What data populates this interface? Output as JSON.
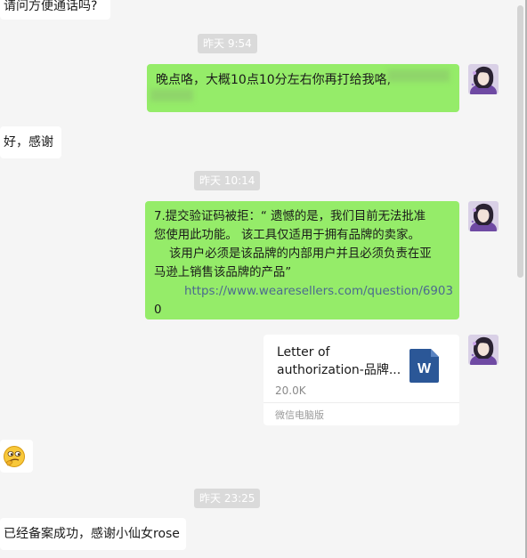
{
  "messages": {
    "m0": "请问方便通话吗?",
    "m1": "晚点咯，大概10点10分左右你再打给我咯,",
    "m2": "好，感谢",
    "m3_line1": "7.提交验证码被拒：“ 遗憾的是，我们目前无法批准",
    "m3_line2": "您使用此功能。 该工具仅适用于拥有品牌的卖家。",
    "m3_line3": "    该用户必须是该品牌的内部用户并且必须负责在亚",
    "m3_line4": "马逊上销售该品牌的产品”",
    "m3_link1": "        https://www.wearesellers.com/question/6903",
    "m3_link2": "0",
    "m5": "已经备案成功，感谢小仙女rose"
  },
  "timestamps": {
    "t1": "昨天 9:54",
    "t2": "昨天 10:14",
    "t3": "昨天 23:25"
  },
  "file_card": {
    "title_line1": "Letter of",
    "title_line2": "authorization-品牌...",
    "size": "20.0K",
    "footer": "微信电脑版",
    "icon_letter": "W"
  },
  "emoji": "thinking-face-icon",
  "colors": {
    "incoming_bubble": "#ffffff",
    "outgoing_bubble": "#95ec69",
    "background": "#f5f5f5",
    "word_icon": "#2b5797"
  }
}
